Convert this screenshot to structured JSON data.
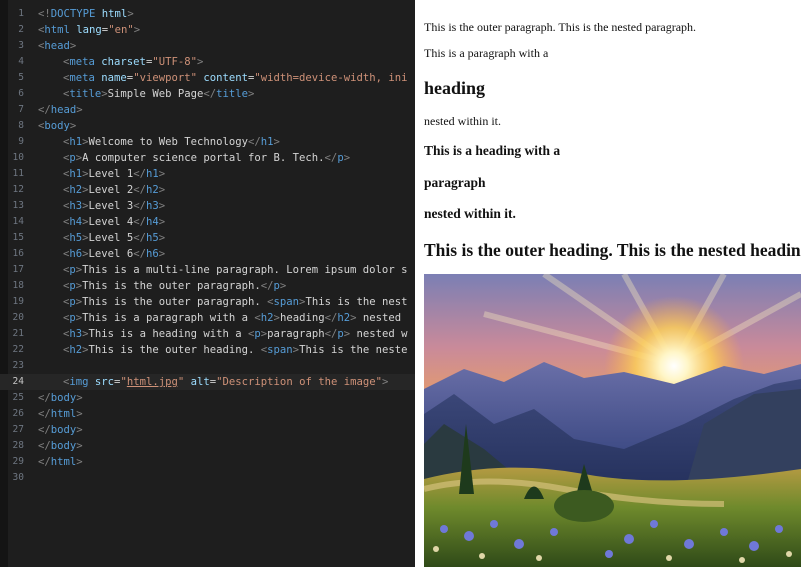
{
  "editor": {
    "active_line": 24,
    "lines": [
      {
        "n": "1",
        "indent": 0,
        "tokens": [
          [
            "p",
            "<!"
          ],
          [
            "t",
            "DOCTYPE "
          ],
          [
            "a",
            "html"
          ],
          [
            "p",
            ">"
          ]
        ]
      },
      {
        "n": "2",
        "indent": 0,
        "tokens": [
          [
            "p",
            "<"
          ],
          [
            "t",
            "html "
          ],
          [
            "a",
            "lang"
          ],
          [
            "x",
            "="
          ],
          [
            "s",
            "\"en\""
          ],
          [
            "p",
            ">"
          ]
        ]
      },
      {
        "n": "3",
        "indent": 0,
        "tokens": [
          [
            "p",
            "<"
          ],
          [
            "t",
            "head"
          ],
          [
            "p",
            ">"
          ]
        ]
      },
      {
        "n": "4",
        "indent": 1,
        "tokens": [
          [
            "p",
            "<"
          ],
          [
            "t",
            "meta "
          ],
          [
            "a",
            "charset"
          ],
          [
            "x",
            "="
          ],
          [
            "s",
            "\"UTF-8\""
          ],
          [
            "p",
            ">"
          ]
        ]
      },
      {
        "n": "5",
        "indent": 1,
        "tokens": [
          [
            "p",
            "<"
          ],
          [
            "t",
            "meta "
          ],
          [
            "a",
            "name"
          ],
          [
            "x",
            "="
          ],
          [
            "s",
            "\"viewport\" "
          ],
          [
            "a",
            "content"
          ],
          [
            "x",
            "="
          ],
          [
            "s",
            "\"width=device-width, ini"
          ]
        ]
      },
      {
        "n": "6",
        "indent": 1,
        "tokens": [
          [
            "p",
            "<"
          ],
          [
            "t",
            "title"
          ],
          [
            "p",
            ">"
          ],
          [
            "x",
            "Simple Web Page"
          ],
          [
            "p",
            "</"
          ],
          [
            "t",
            "title"
          ],
          [
            "p",
            ">"
          ]
        ]
      },
      {
        "n": "7",
        "indent": 0,
        "tokens": [
          [
            "p",
            "</"
          ],
          [
            "t",
            "head"
          ],
          [
            "p",
            ">"
          ]
        ]
      },
      {
        "n": "8",
        "indent": 0,
        "tokens": [
          [
            "p",
            "<"
          ],
          [
            "t",
            "body"
          ],
          [
            "p",
            ">"
          ]
        ]
      },
      {
        "n": "9",
        "indent": 1,
        "tokens": [
          [
            "p",
            "<"
          ],
          [
            "t",
            "h1"
          ],
          [
            "p",
            ">"
          ],
          [
            "x",
            "Welcome to Web Technology"
          ],
          [
            "p",
            "</"
          ],
          [
            "t",
            "h1"
          ],
          [
            "p",
            ">"
          ]
        ]
      },
      {
        "n": "10",
        "indent": 1,
        "tokens": [
          [
            "p",
            "<"
          ],
          [
            "t",
            "p"
          ],
          [
            "p",
            ">"
          ],
          [
            "x",
            "A computer science portal for B. Tech."
          ],
          [
            "p",
            "</"
          ],
          [
            "t",
            "p"
          ],
          [
            "p",
            ">"
          ]
        ]
      },
      {
        "n": "11",
        "indent": 1,
        "tokens": [
          [
            "p",
            "<"
          ],
          [
            "t",
            "h1"
          ],
          [
            "p",
            ">"
          ],
          [
            "x",
            "Level 1"
          ],
          [
            "p",
            "</"
          ],
          [
            "t",
            "h1"
          ],
          [
            "p",
            ">"
          ]
        ]
      },
      {
        "n": "12",
        "indent": 1,
        "tokens": [
          [
            "p",
            "<"
          ],
          [
            "t",
            "h2"
          ],
          [
            "p",
            ">"
          ],
          [
            "x",
            "Level 2"
          ],
          [
            "p",
            "</"
          ],
          [
            "t",
            "h2"
          ],
          [
            "p",
            ">"
          ]
        ]
      },
      {
        "n": "13",
        "indent": 1,
        "tokens": [
          [
            "p",
            "<"
          ],
          [
            "t",
            "h3"
          ],
          [
            "p",
            ">"
          ],
          [
            "x",
            "Level 3"
          ],
          [
            "p",
            "</"
          ],
          [
            "t",
            "h3"
          ],
          [
            "p",
            ">"
          ]
        ]
      },
      {
        "n": "14",
        "indent": 1,
        "tokens": [
          [
            "p",
            "<"
          ],
          [
            "t",
            "h4"
          ],
          [
            "p",
            ">"
          ],
          [
            "x",
            "Level 4"
          ],
          [
            "p",
            "</"
          ],
          [
            "t",
            "h4"
          ],
          [
            "p",
            ">"
          ]
        ]
      },
      {
        "n": "15",
        "indent": 1,
        "tokens": [
          [
            "p",
            "<"
          ],
          [
            "t",
            "h5"
          ],
          [
            "p",
            ">"
          ],
          [
            "x",
            "Level 5"
          ],
          [
            "p",
            "</"
          ],
          [
            "t",
            "h5"
          ],
          [
            "p",
            ">"
          ]
        ]
      },
      {
        "n": "16",
        "indent": 1,
        "tokens": [
          [
            "p",
            "<"
          ],
          [
            "t",
            "h6"
          ],
          [
            "p",
            ">"
          ],
          [
            "x",
            "Level 6"
          ],
          [
            "p",
            "</"
          ],
          [
            "t",
            "h6"
          ],
          [
            "p",
            ">"
          ]
        ]
      },
      {
        "n": "17",
        "indent": 1,
        "tokens": [
          [
            "p",
            "<"
          ],
          [
            "t",
            "p"
          ],
          [
            "p",
            ">"
          ],
          [
            "x",
            "This is a multi-line paragraph. Lorem ipsum dolor s"
          ]
        ]
      },
      {
        "n": "18",
        "indent": 1,
        "tokens": [
          [
            "p",
            "<"
          ],
          [
            "t",
            "p"
          ],
          [
            "p",
            ">"
          ],
          [
            "x",
            "This is the outer paragraph."
          ],
          [
            "p",
            "</"
          ],
          [
            "t",
            "p"
          ],
          [
            "p",
            ">"
          ]
        ]
      },
      {
        "n": "19",
        "indent": 1,
        "tokens": [
          [
            "p",
            "<"
          ],
          [
            "t",
            "p"
          ],
          [
            "p",
            ">"
          ],
          [
            "x",
            "This is the outer paragraph. "
          ],
          [
            "p",
            "<"
          ],
          [
            "t",
            "span"
          ],
          [
            "p",
            ">"
          ],
          [
            "x",
            "This is the nest"
          ]
        ]
      },
      {
        "n": "20",
        "indent": 1,
        "tokens": [
          [
            "p",
            "<"
          ],
          [
            "t",
            "p"
          ],
          [
            "p",
            ">"
          ],
          [
            "x",
            "This is a paragraph with a "
          ],
          [
            "p",
            "<"
          ],
          [
            "t",
            "h2"
          ],
          [
            "p",
            ">"
          ],
          [
            "x",
            "heading"
          ],
          [
            "p",
            "</"
          ],
          [
            "t",
            "h2"
          ],
          [
            "p",
            "> "
          ],
          [
            "x",
            "nested "
          ]
        ]
      },
      {
        "n": "21",
        "indent": 1,
        "tokens": [
          [
            "p",
            "<"
          ],
          [
            "t",
            "h3"
          ],
          [
            "p",
            ">"
          ],
          [
            "x",
            "This is a heading with a "
          ],
          [
            "p",
            "<"
          ],
          [
            "t",
            "p"
          ],
          [
            "p",
            ">"
          ],
          [
            "x",
            "paragraph"
          ],
          [
            "p",
            "</"
          ],
          [
            "t",
            "p"
          ],
          [
            "p",
            "> "
          ],
          [
            "x",
            "nested w"
          ]
        ]
      },
      {
        "n": "22",
        "indent": 1,
        "tokens": [
          [
            "p",
            "<"
          ],
          [
            "t",
            "h2"
          ],
          [
            "p",
            ">"
          ],
          [
            "x",
            "This is the outer heading. "
          ],
          [
            "p",
            "<"
          ],
          [
            "t",
            "span"
          ],
          [
            "p",
            ">"
          ],
          [
            "x",
            "This is the neste"
          ]
        ]
      },
      {
        "n": "23",
        "indent": 0,
        "tokens": []
      },
      {
        "n": "24",
        "indent": 1,
        "tokens": [
          [
            "p",
            "<"
          ],
          [
            "t",
            "img "
          ],
          [
            "a",
            "src"
          ],
          [
            "x",
            "="
          ],
          [
            "s",
            "\""
          ],
          [
            "sl",
            "html.jpg"
          ],
          [
            "s",
            "\" "
          ],
          [
            "a",
            "alt"
          ],
          [
            "x",
            "="
          ],
          [
            "s",
            "\"Description of the image\""
          ],
          [
            "p",
            ">"
          ]
        ]
      },
      {
        "n": "25",
        "indent": 0,
        "tokens": [
          [
            "p",
            "</"
          ],
          [
            "t",
            "body"
          ],
          [
            "p",
            ">"
          ]
        ]
      },
      {
        "n": "26",
        "indent": 0,
        "tokens": [
          [
            "p",
            "</"
          ],
          [
            "t",
            "html"
          ],
          [
            "p",
            ">"
          ]
        ]
      },
      {
        "n": "27",
        "indent": 0,
        "tokens": [
          [
            "p",
            "</"
          ],
          [
            "t",
            "body"
          ],
          [
            "p",
            ">"
          ]
        ]
      },
      {
        "n": "28",
        "indent": 0,
        "tokens": [
          [
            "p",
            "</"
          ],
          [
            "t",
            "body"
          ],
          [
            "p",
            ">"
          ]
        ]
      },
      {
        "n": "29",
        "indent": 0,
        "tokens": [
          [
            "p",
            "</"
          ],
          [
            "t",
            "html"
          ],
          [
            "p",
            ">"
          ]
        ]
      },
      {
        "n": "30",
        "indent": 0,
        "tokens": []
      }
    ]
  },
  "preview": {
    "line1": "This is the outer paragraph. This is the nested paragraph.",
    "line2": "This is a paragraph with a",
    "heading_word": "heading",
    "line3": "nested within it.",
    "h3_line1": "This is a heading with a",
    "h3_line2": "paragraph",
    "h3_line3": "nested within it.",
    "h2_outer": "This is the outer heading. This is the nested heading."
  },
  "colors": {
    "editor_bg": "#1e1e1e",
    "tag": "#569cd6",
    "attr": "#9cdcfe",
    "string": "#ce9178",
    "text": "#d4d4d4"
  }
}
